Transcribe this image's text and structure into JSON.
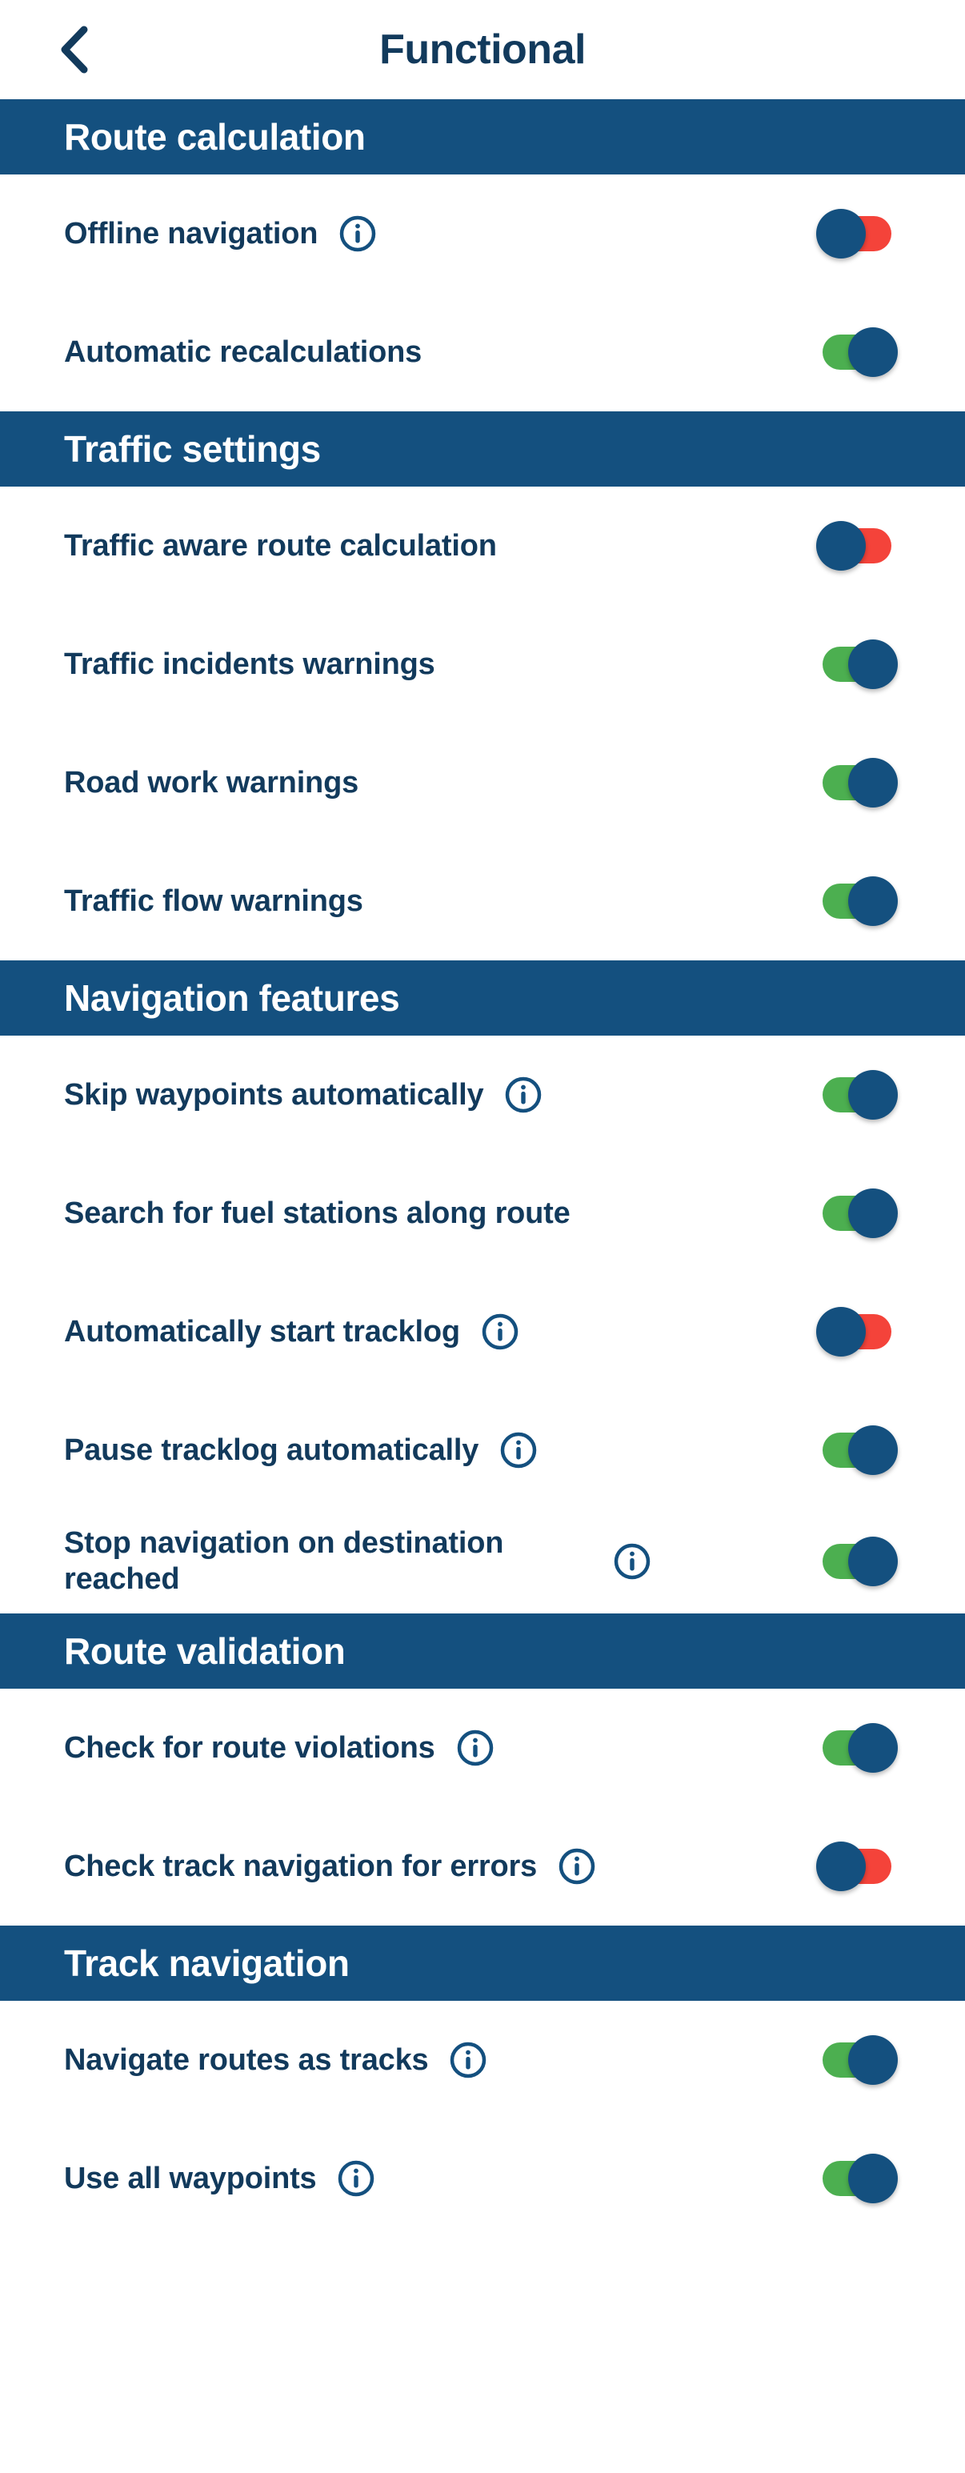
{
  "header": {
    "back_icon": "chevron-left-icon",
    "title": "Functional"
  },
  "colors": {
    "section_header_bg": "#14507F",
    "text": "#123A5C",
    "toggle_on_track": "#4CAF50",
    "toggle_off_track": "#F4433A",
    "toggle_knob": "#14507F",
    "page_bg": "#FFFFFF"
  },
  "info_icon_name": "info-icon",
  "toggle_states": {
    "on": "on",
    "off": "off"
  },
  "sections": [
    {
      "title": "Route calculation",
      "rows": [
        {
          "label": "Offline navigation",
          "info": true,
          "state": "off"
        },
        {
          "label": "Automatic recalculations",
          "info": false,
          "state": "on"
        }
      ]
    },
    {
      "title": "Traffic settings",
      "rows": [
        {
          "label": "Traffic aware route calculation",
          "info": false,
          "state": "off"
        },
        {
          "label": "Traffic incidents warnings",
          "info": false,
          "state": "on"
        },
        {
          "label": "Road work warnings",
          "info": false,
          "state": "on"
        },
        {
          "label": "Traffic flow warnings",
          "info": false,
          "state": "on"
        }
      ]
    },
    {
      "title": "Navigation features",
      "rows": [
        {
          "label": "Skip waypoints automatically",
          "info": true,
          "state": "on"
        },
        {
          "label": "Search for fuel stations along route",
          "info": false,
          "state": "on"
        },
        {
          "label": "Automatically start tracklog",
          "info": true,
          "state": "off"
        },
        {
          "label": "Pause tracklog automatically",
          "info": true,
          "state": "on"
        },
        {
          "label": "Stop navigation on destination reached",
          "info": true,
          "state": "on",
          "two_line": true
        }
      ]
    },
    {
      "title": "Route validation",
      "rows": [
        {
          "label": "Check for route violations",
          "info": true,
          "state": "on"
        },
        {
          "label": "Check track navigation for errors",
          "info": true,
          "state": "off"
        }
      ]
    },
    {
      "title": "Track navigation",
      "rows": [
        {
          "label": "Navigate routes as tracks",
          "info": true,
          "state": "on"
        },
        {
          "label": "Use all waypoints",
          "info": true,
          "state": "on"
        }
      ]
    }
  ]
}
